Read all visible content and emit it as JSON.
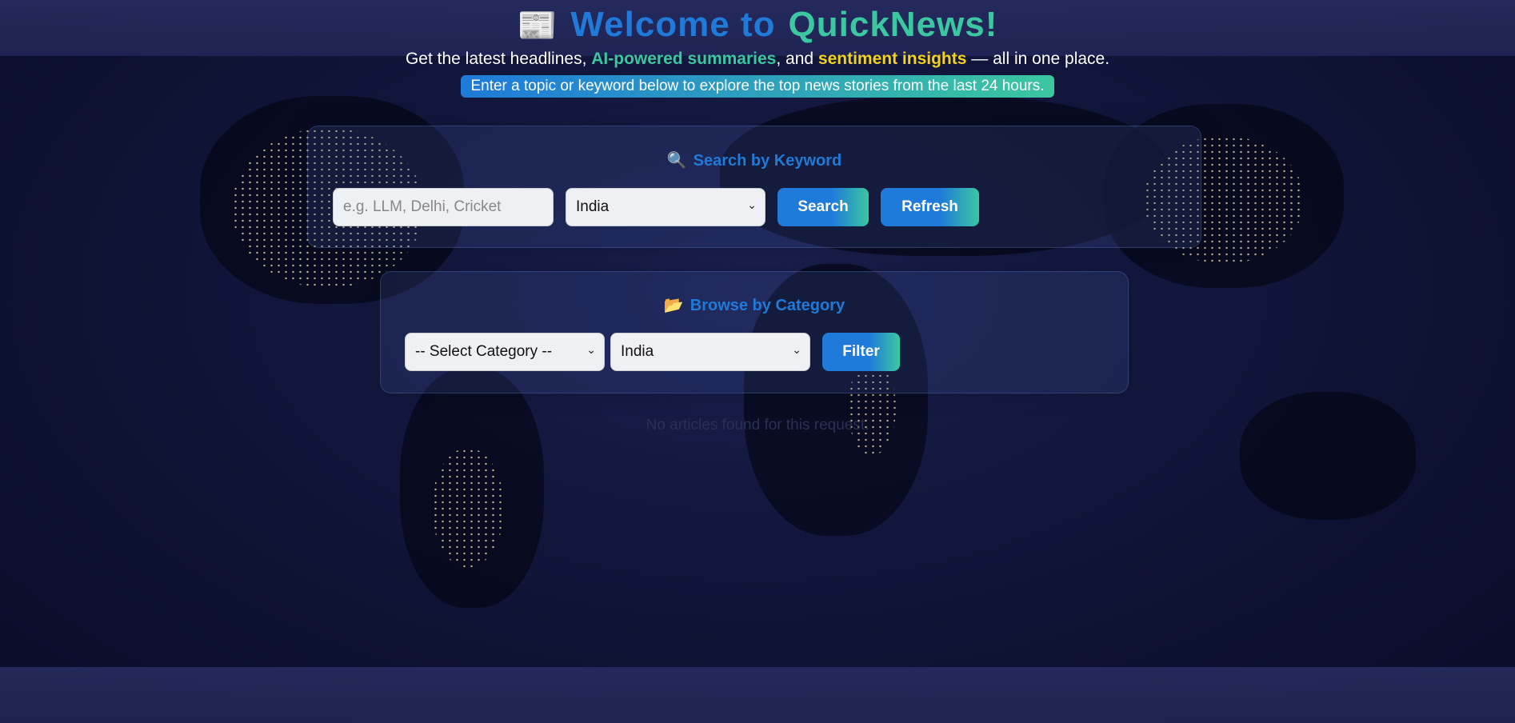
{
  "header": {
    "icon": "newspaper-icon",
    "welcome": "Welcome to",
    "brand": "QuickNews!",
    "subtitle_prefix": "Get the latest headlines,",
    "subtitle_ai": "AI-powered summaries",
    "subtitle_mid": ", and",
    "subtitle_sentiment": "sentiment insights",
    "subtitle_suffix": "— all in one place.",
    "instruction": "Enter a topic or keyword below to explore the top news stories from the last 24 hours."
  },
  "search": {
    "icon": "magnifier-icon",
    "heading": "Search by Keyword",
    "keyword_placeholder": "e.g. LLM, Delhi, Cricket",
    "keyword_value": "",
    "country_selected": "India",
    "search_label": "Search",
    "refresh_label": "Refresh"
  },
  "category": {
    "icon": "folder-icon",
    "heading": "Browse by Category",
    "category_selected": "-- Select Category --",
    "country_selected": "India",
    "filter_label": "Filter"
  },
  "results": {
    "empty_message": "No articles found for this request."
  },
  "colors": {
    "primary": "#1f7ad9",
    "accent": "#3bc7a0",
    "highlight": "#f2d21b"
  }
}
